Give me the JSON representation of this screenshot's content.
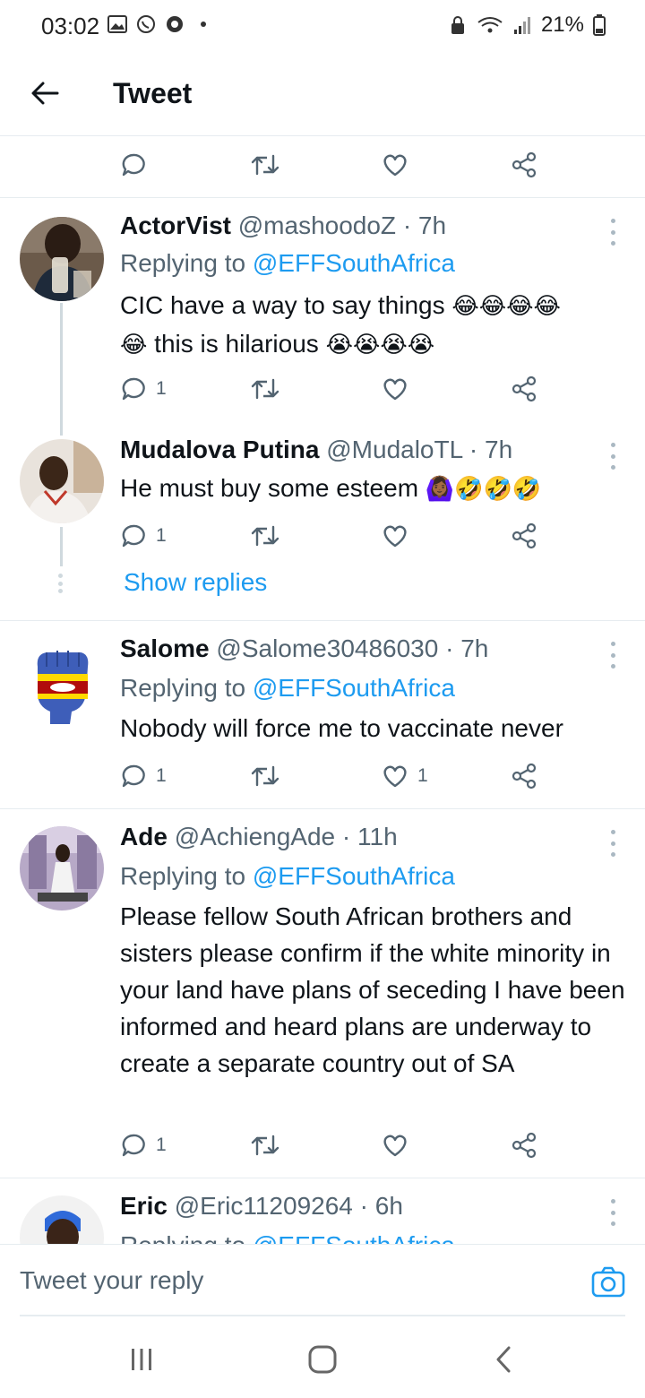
{
  "status_bar": {
    "time": "03:02",
    "battery": "21%"
  },
  "header": {
    "title": "Tweet"
  },
  "top_actions": {
    "reply_count": "",
    "like_count": ""
  },
  "replying_prefix": "Replying to",
  "tweets": [
    {
      "name": "ActorVist",
      "meta": "@mashoodoZ · 7h",
      "replying_to": "@EFFSouthAfrica",
      "text_line1": "CIC have a way to say things",
      "text_line1_emoji": "😂😂😂😂",
      "text_line2_emoji_prefix": "😂",
      "text_line2": "this is hilarious",
      "text_line2_emoji": "😭😭😭😭",
      "reply_count": "1",
      "like_count": ""
    },
    {
      "name": "Mudalova Putina",
      "meta": "@MudaloTL · 7h",
      "text": "He must buy some esteem",
      "text_emoji": "🙆🏾‍♀️🤣🤣🤣",
      "reply_count": "1",
      "like_count": ""
    },
    {
      "name": "Salome",
      "meta": "@Salome30486030 · 7h",
      "replying_to": "@EFFSouthAfrica",
      "text": "Nobody will force me to vaccinate never",
      "reply_count": "1",
      "like_count": "1"
    },
    {
      "name": "Ade",
      "meta": "@AchiengAde · 11h",
      "replying_to": "@EFFSouthAfrica",
      "text": "Please fellow South African brothers and sisters please confirm if the white minority in your land have plans of seceding I have been informed and heard plans are underway to create a separate country out of SA",
      "reply_count": "1",
      "like_count": ""
    },
    {
      "name": "Eric",
      "meta": "@Eric11209264 · 6h",
      "replying_to": "@EFFSouthAfrica"
    }
  ],
  "show_replies": "Show replies",
  "composer": {
    "placeholder": "Tweet your reply"
  },
  "colors": {
    "accent": "#1d9bf0",
    "muted": "#536471",
    "divider": "#e6ecf0"
  },
  "icons": [
    "back-arrow-icon",
    "reply-icon",
    "retweet-icon",
    "like-icon",
    "share-icon",
    "more-icon",
    "camera-icon",
    "recent-apps-icon",
    "home-icon",
    "nav-back-icon"
  ]
}
